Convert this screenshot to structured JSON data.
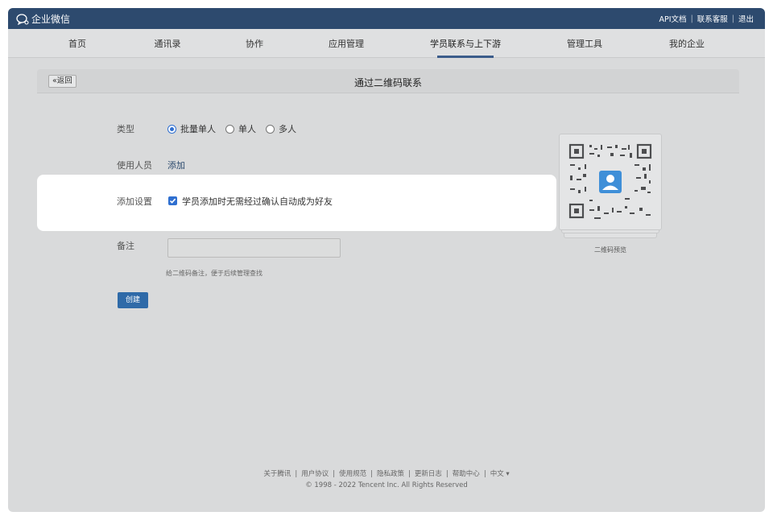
{
  "topbar": {
    "app_name": "企业微信",
    "links": [
      "API文档",
      "联系客服",
      "退出"
    ]
  },
  "nav": {
    "items": [
      "首页",
      "通讯录",
      "协作",
      "应用管理",
      "学员联系与上下游",
      "管理工具",
      "我的企业"
    ],
    "active_index": 4
  },
  "panel": {
    "back_label": "«返回",
    "title": "通过二维码联系"
  },
  "form": {
    "type_label": "类型",
    "type_options": [
      "批量单人",
      "单人",
      "多人"
    ],
    "type_selected": "批量单人",
    "users_label": "使用人员",
    "users_add": "添加",
    "settings_label": "添加设置",
    "settings_checkbox_label": "学员添加时无需经过确认自动成为好友",
    "settings_checked": true,
    "note_label": "备注",
    "note_value": "",
    "note_hint": "给二维码备注，便于后续管理查找",
    "create_label": "创建"
  },
  "qr": {
    "preview_label": "二维码预览"
  },
  "footer": {
    "links": [
      "关于腾讯",
      "用户协议",
      "使用规范",
      "隐私政策",
      "更新日志",
      "帮助中心",
      "中文 ▾"
    ],
    "copyright": "© 1998 - 2022 Tencent Inc. All Rights Reserved"
  },
  "colors": {
    "topbar": "#2d4a6e",
    "accent": "#2f6fd0",
    "button": "#2f6aa8"
  }
}
